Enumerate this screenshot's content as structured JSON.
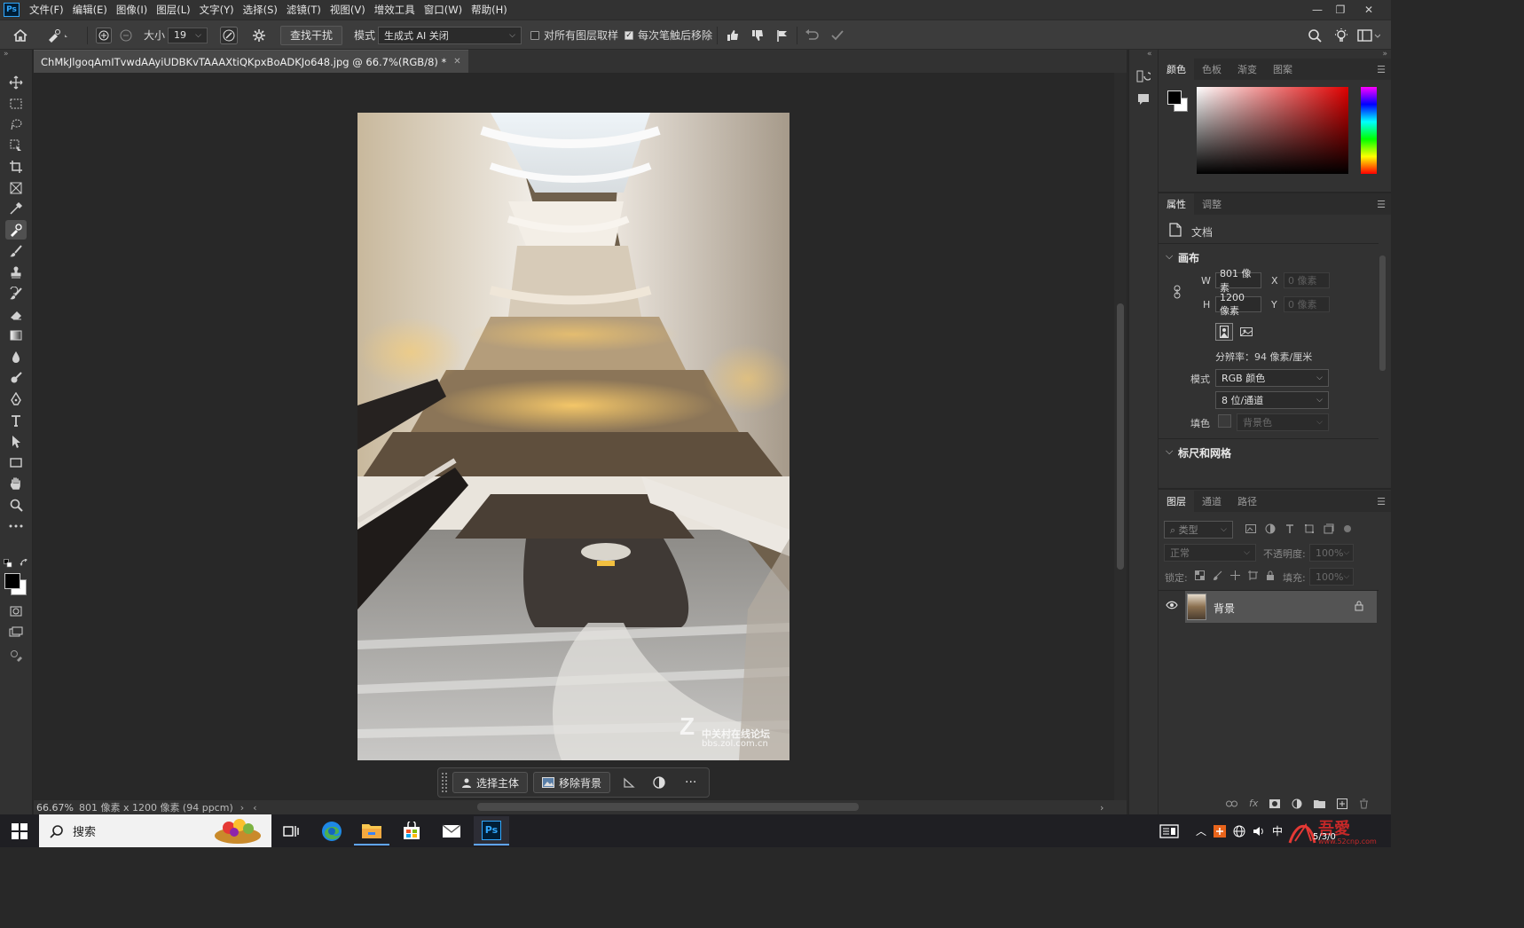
{
  "app": {
    "logo_text": "Ps"
  },
  "menu": [
    "文件(F)",
    "编辑(E)",
    "图像(I)",
    "图层(L)",
    "文字(Y)",
    "选择(S)",
    "滤镜(T)",
    "视图(V)",
    "增效工具",
    "窗口(W)",
    "帮助(H)"
  ],
  "options": {
    "size_label": "大小",
    "size_value": "19",
    "find_button": "查找干扰",
    "mode_label": "模式",
    "mode_value": "生成式 AI 关闭",
    "sample_all_layers": "对所有图层取样",
    "remove_after_stroke": "每次笔触后移除",
    "sample_all_checked": false,
    "remove_after_checked": true
  },
  "document": {
    "tab_title": "ChMkJlgoqAmITvwdAAyiUDBKvTAAAXtiQKpxBoADKJo648.jpg @ 66.7%(RGB/8) *",
    "watermark_line1": "中关村在线论坛",
    "watermark_line2": "bbs.zol.com.cn"
  },
  "context_bar": {
    "select_subject": "选择主体",
    "remove_bg": "移除背景"
  },
  "status": {
    "zoom": "66.67%",
    "info": "801 像素 x 1200 像素 (94 ppcm)"
  },
  "color_panel": {
    "tabs": [
      "颜色",
      "色板",
      "渐变",
      "图案"
    ],
    "active_tab": "颜色",
    "hue_color": "#e00000"
  },
  "properties_panel": {
    "tabs": [
      "属性",
      "调整"
    ],
    "doc_label": "文档",
    "canvas_section": "画布",
    "w_label": "W",
    "w_value": "801 像素",
    "h_label": "H",
    "h_value": "1200 像素",
    "x_label": "X",
    "x_value": "0 像素",
    "y_label": "Y",
    "y_value": "0 像素",
    "resolution": "分辨率：94 像素/厘米",
    "mode_label": "模式",
    "mode_value": "RGB 颜色",
    "depth_value": "8 位/通道",
    "fill_label": "填色",
    "fill_value": "背景色",
    "rulers_section": "标尺和网格"
  },
  "layers_panel": {
    "tabs": [
      "图层",
      "通道",
      "路径"
    ],
    "filter_placeholder": "类型",
    "blend_mode": "正常",
    "opacity_label": "不透明度:",
    "opacity_value": "100%",
    "lock_label": "锁定:",
    "fill_label": "填充:",
    "fill_value": "100%",
    "layers": [
      {
        "name": "背景",
        "visible": true,
        "locked": true
      }
    ]
  },
  "taskbar": {
    "search_placeholder": "搜索",
    "ime_lang": "中",
    "time": "5/3/0"
  }
}
